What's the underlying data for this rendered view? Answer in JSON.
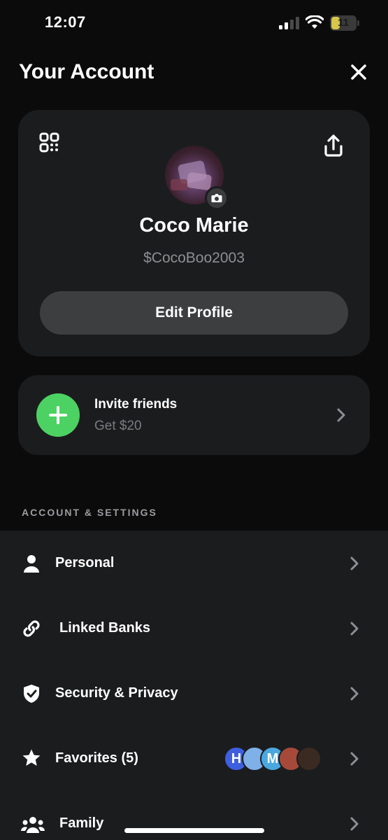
{
  "status_bar": {
    "time": "12:07",
    "battery_level": "11",
    "battery_fraction": 0.11,
    "battery_color": "#d7c64a"
  },
  "header": {
    "title": "Your Account",
    "close_icon": "close-icon"
  },
  "profile": {
    "name": "Coco Marie",
    "handle": "$CocoBoo2003",
    "edit_label": "Edit Profile",
    "qr_icon": "qr-code-icon",
    "share_icon": "share-icon",
    "camera_icon": "camera-icon"
  },
  "invite": {
    "title": "Invite friends",
    "subtitle": "Get $20",
    "icon": "plus-icon",
    "accent": "#4cd262"
  },
  "settings": {
    "section_title": "ACCOUNT & SETTINGS",
    "items": [
      {
        "label": "Personal",
        "icon": "person-icon"
      },
      {
        "label": "Linked Banks",
        "icon": "link-icon"
      },
      {
        "label": "Security & Privacy",
        "icon": "shield-check-icon"
      },
      {
        "label": "Favorites (5)",
        "icon": "star-icon"
      },
      {
        "label": "Family",
        "icon": "family-icon"
      }
    ],
    "favorites_avatars": [
      {
        "initial": "H",
        "color": "#3d5fe0"
      },
      {
        "initial": "",
        "color": "#7fb0e8"
      },
      {
        "initial": "M",
        "color": "#4aa8e0"
      },
      {
        "initial": "",
        "color": "#a54a3a"
      },
      {
        "initial": "",
        "color": "#3a2a22"
      }
    ]
  }
}
